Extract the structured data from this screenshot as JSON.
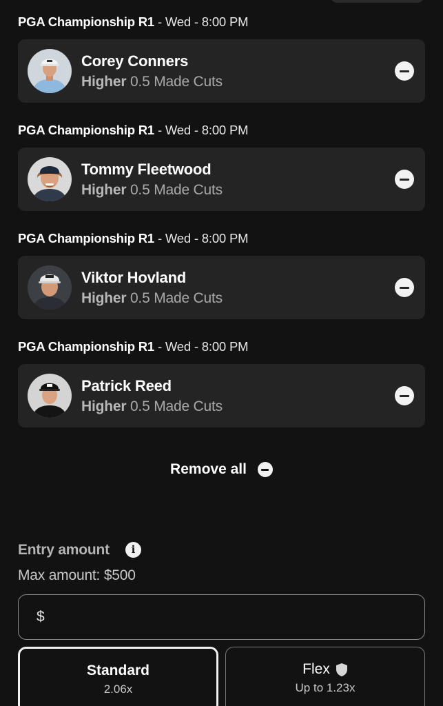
{
  "picks": [
    {
      "event": "PGA Championship R1",
      "time": " - Wed - 8:00 PM",
      "player": "Corey Conners",
      "direction": "Higher",
      "line": "0.5",
      "stat": "Made Cuts",
      "avatar_icon": "player-photo-corey-conners"
    },
    {
      "event": "PGA Championship R1",
      "time": " - Wed - 8:00 PM",
      "player": "Tommy Fleetwood",
      "direction": "Higher",
      "line": "0.5",
      "stat": "Made Cuts",
      "avatar_icon": "player-photo-tommy-fleetwood"
    },
    {
      "event": "PGA Championship R1",
      "time": " - Wed - 8:00 PM",
      "player": "Viktor Hovland",
      "direction": "Higher",
      "line": "0.5",
      "stat": "Made Cuts",
      "avatar_icon": "player-photo-viktor-hovland"
    },
    {
      "event": "PGA Championship R1",
      "time": " - Wed - 8:00 PM",
      "player": "Patrick Reed",
      "direction": "Higher",
      "line": "0.5",
      "stat": "Made Cuts",
      "avatar_icon": "player-photo-patrick-reed"
    }
  ],
  "remove_all": {
    "label": "Remove all",
    "icon": "minus-circle-icon"
  },
  "entry": {
    "label": "Entry amount",
    "info_icon": "info-icon",
    "max_amount": "Max amount: $500",
    "currency_symbol": "$",
    "value": ""
  },
  "modes": {
    "standard": {
      "title": "Standard",
      "multiplier": "2.06x",
      "selected": true
    },
    "flex": {
      "title": "Flex",
      "multiplier": "Up to 1.23x",
      "icon": "shield-icon",
      "selected": false
    }
  },
  "colors": {
    "background": "#121212",
    "card": "#242424",
    "text": "#ffffff",
    "muted": "#a9a9a9"
  }
}
